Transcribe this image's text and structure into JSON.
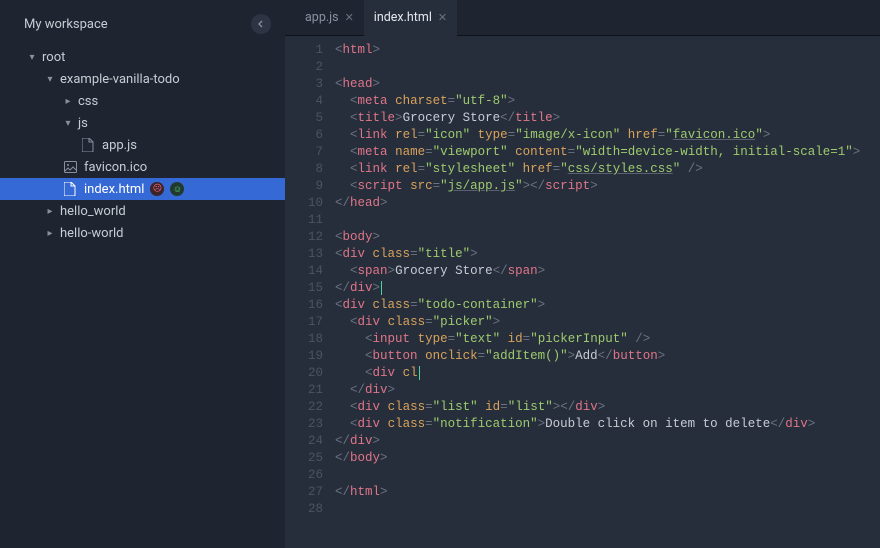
{
  "workspace": {
    "title": "My workspace"
  },
  "tree": {
    "root": "root",
    "folder_example": "example-vanilla-todo",
    "folder_css": "css",
    "folder_js": "js",
    "file_appjs": "app.js",
    "file_favicon": "favicon.ico",
    "file_index": "index.html",
    "folder_hello_underscore": "hello_world",
    "folder_hello_dash": "hello-world"
  },
  "tabs": {
    "t1": "app.js",
    "t2": "index.html"
  },
  "lines": {
    "l1": "<html>",
    "l2": "",
    "l3": "<head>",
    "l4": "  <meta charset=\"utf-8\">",
    "l5": "  <title>Grocery Store</title>",
    "l6": "  <link rel=\"icon\" type=\"image/x-icon\" href=\"favicon.ico\">",
    "l7": "  <meta name=\"viewport\" content=\"width=device-width, initial-scale=1\">",
    "l8": "  <link rel=\"stylesheet\" href=\"css/styles.css\" />",
    "l9": "  <script src=\"js/app.js\"></script>",
    "l10": "</head>",
    "l11": "",
    "l12": "<body>",
    "l13": "<div class=\"title\">",
    "l14": "  <span>Grocery Store</span>",
    "l15": "</div>",
    "l16": "<div class=\"todo-container\">",
    "l17": "  <div class=\"picker\">",
    "l18": "    <input type=\"text\" id=\"pickerInput\" />",
    "l19": "    <button onclick=\"addItem()\">Add</button>",
    "l20": "    <div cl",
    "l21": "  </div>",
    "l22": "  <div class=\"list\" id=\"list\"></div>",
    "l23": "  <div class=\"notification\">Double click on item to delete</div>",
    "l24": "</div>",
    "l25": "</body>",
    "l26": "",
    "l27": "</html>",
    "l28": ""
  },
  "line_numbers": [
    "1",
    "2",
    "3",
    "4",
    "5",
    "6",
    "7",
    "8",
    "9",
    "10",
    "11",
    "12",
    "13",
    "14",
    "15",
    "16",
    "17",
    "18",
    "19",
    "20",
    "21",
    "22",
    "23",
    "24",
    "25",
    "26",
    "27",
    "28"
  ]
}
